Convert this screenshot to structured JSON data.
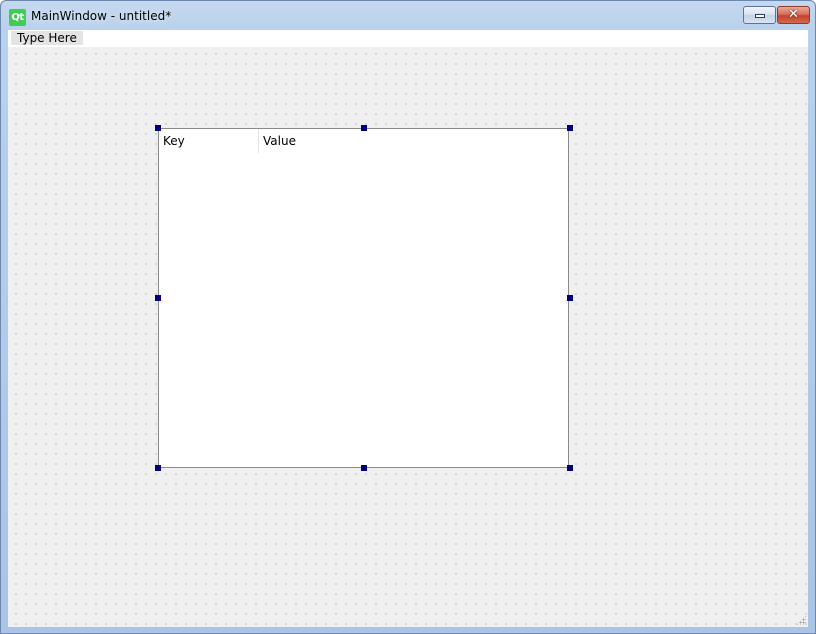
{
  "window": {
    "title": "MainWindow - untitled*",
    "icon": "qt-logo-icon",
    "icon_text": "Qt",
    "minimize_glyph": "",
    "close_glyph": "✕"
  },
  "menubar": {
    "items": [
      {
        "label": "Type Here"
      }
    ]
  },
  "tree_widget": {
    "columns": [
      "Key",
      "Value"
    ]
  },
  "colors": {
    "selection_handle": "#000080",
    "qt_logo": "#41cd52",
    "canvas_background": "#f0f0f0"
  }
}
